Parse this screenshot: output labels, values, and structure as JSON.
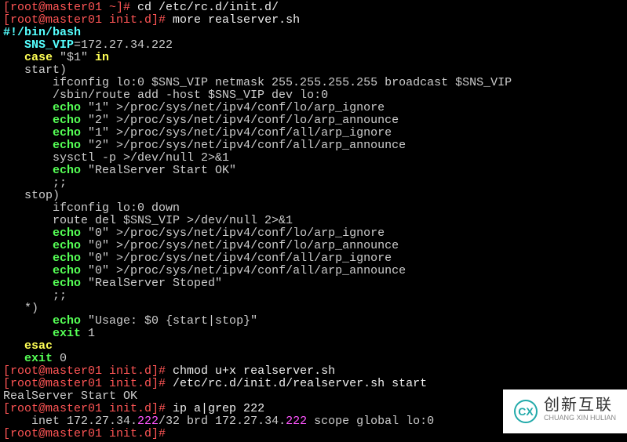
{
  "terminal": {
    "lines": [
      {
        "segments": [
          {
            "text": "[root@master01 ~]# ",
            "class": "red"
          },
          {
            "text": "cd /etc/rc.d/init.d/",
            "class": "white"
          }
        ]
      },
      {
        "segments": [
          {
            "text": "[root@master01 init.d]# ",
            "class": "red"
          },
          {
            "text": "more realserver.sh",
            "class": "white"
          }
        ]
      },
      {
        "segments": [
          {
            "text": "#!/bin/bash",
            "class": "cyan-bold"
          }
        ]
      },
      {
        "segments": [
          {
            "text": "   ",
            "class": "gray"
          },
          {
            "text": "SNS_VIP",
            "class": "cyan-bold"
          },
          {
            "text": "=172.27.34.222",
            "class": "gray"
          }
        ]
      },
      {
        "segments": [
          {
            "text": "   ",
            "class": "gray"
          },
          {
            "text": "case",
            "class": "yellow-bold"
          },
          {
            "text": " \"$1\" ",
            "class": "gray"
          },
          {
            "text": "in",
            "class": "yellow-bold"
          }
        ]
      },
      {
        "segments": [
          {
            "text": "   start)",
            "class": "gray"
          }
        ]
      },
      {
        "segments": [
          {
            "text": "       ifconfig lo:0 $SNS_VIP netmask 255.255.255.255 broadcast $SNS_VIP",
            "class": "gray"
          }
        ]
      },
      {
        "segments": [
          {
            "text": "       /sbin/route add -host $SNS_VIP dev lo:0",
            "class": "gray"
          }
        ]
      },
      {
        "segments": [
          {
            "text": "       ",
            "class": "gray"
          },
          {
            "text": "echo",
            "class": "green-bold"
          },
          {
            "text": " \"1\" >/proc/sys/net/ipv4/conf/lo/arp_ignore",
            "class": "gray"
          }
        ]
      },
      {
        "segments": [
          {
            "text": "       ",
            "class": "gray"
          },
          {
            "text": "echo",
            "class": "green-bold"
          },
          {
            "text": " \"2\" >/proc/sys/net/ipv4/conf/lo/arp_announce",
            "class": "gray"
          }
        ]
      },
      {
        "segments": [
          {
            "text": "       ",
            "class": "gray"
          },
          {
            "text": "echo",
            "class": "green-bold"
          },
          {
            "text": " \"1\" >/proc/sys/net/ipv4/conf/all/arp_ignore",
            "class": "gray"
          }
        ]
      },
      {
        "segments": [
          {
            "text": "       ",
            "class": "gray"
          },
          {
            "text": "echo",
            "class": "green-bold"
          },
          {
            "text": " \"2\" >/proc/sys/net/ipv4/conf/all/arp_announce",
            "class": "gray"
          }
        ]
      },
      {
        "segments": [
          {
            "text": "       sysctl -p >/dev/null 2>&1",
            "class": "gray"
          }
        ]
      },
      {
        "segments": [
          {
            "text": "       ",
            "class": "gray"
          },
          {
            "text": "echo",
            "class": "green-bold"
          },
          {
            "text": " \"RealServer Start OK\"",
            "class": "gray"
          }
        ]
      },
      {
        "segments": [
          {
            "text": "       ;;",
            "class": "gray"
          }
        ]
      },
      {
        "segments": [
          {
            "text": "   stop)",
            "class": "gray"
          }
        ]
      },
      {
        "segments": [
          {
            "text": "       ifconfig lo:0 down",
            "class": "gray"
          }
        ]
      },
      {
        "segments": [
          {
            "text": "       route del $SNS_VIP >/dev/null 2>&1",
            "class": "gray"
          }
        ]
      },
      {
        "segments": [
          {
            "text": "       ",
            "class": "gray"
          },
          {
            "text": "echo",
            "class": "green-bold"
          },
          {
            "text": " \"0\" >/proc/sys/net/ipv4/conf/lo/arp_ignore",
            "class": "gray"
          }
        ]
      },
      {
        "segments": [
          {
            "text": "       ",
            "class": "gray"
          },
          {
            "text": "echo",
            "class": "green-bold"
          },
          {
            "text": " \"0\" >/proc/sys/net/ipv4/conf/lo/arp_announce",
            "class": "gray"
          }
        ]
      },
      {
        "segments": [
          {
            "text": "       ",
            "class": "gray"
          },
          {
            "text": "echo",
            "class": "green-bold"
          },
          {
            "text": " \"0\" >/proc/sys/net/ipv4/conf/all/arp_ignore",
            "class": "gray"
          }
        ]
      },
      {
        "segments": [
          {
            "text": "       ",
            "class": "gray"
          },
          {
            "text": "echo",
            "class": "green-bold"
          },
          {
            "text": " \"0\" >/proc/sys/net/ipv4/conf/all/arp_announce",
            "class": "gray"
          }
        ]
      },
      {
        "segments": [
          {
            "text": "       ",
            "class": "gray"
          },
          {
            "text": "echo",
            "class": "green-bold"
          },
          {
            "text": " \"RealServer Stoped\"",
            "class": "gray"
          }
        ]
      },
      {
        "segments": [
          {
            "text": "       ;;",
            "class": "gray"
          }
        ]
      },
      {
        "segments": [
          {
            "text": "   *)",
            "class": "gray"
          }
        ]
      },
      {
        "segments": [
          {
            "text": "       ",
            "class": "gray"
          },
          {
            "text": "echo",
            "class": "green-bold"
          },
          {
            "text": " \"Usage: $0 {start|stop}\"",
            "class": "gray"
          }
        ]
      },
      {
        "segments": [
          {
            "text": "       ",
            "class": "gray"
          },
          {
            "text": "exit",
            "class": "green-bold"
          },
          {
            "text": " 1",
            "class": "gray"
          }
        ]
      },
      {
        "segments": [
          {
            "text": "   ",
            "class": "gray"
          },
          {
            "text": "esac",
            "class": "yellow-bold"
          }
        ]
      },
      {
        "segments": [
          {
            "text": "   ",
            "class": "gray"
          },
          {
            "text": "exit",
            "class": "green-bold"
          },
          {
            "text": " 0",
            "class": "gray"
          }
        ]
      },
      {
        "segments": [
          {
            "text": "[root@master01 init.d]# ",
            "class": "red"
          },
          {
            "text": "chmod u+x realserver.sh",
            "class": "white"
          }
        ]
      },
      {
        "segments": [
          {
            "text": "[root@master01 init.d]# ",
            "class": "red"
          },
          {
            "text": "/etc/rc.d/init.d/realserver.sh start",
            "class": "white"
          }
        ]
      },
      {
        "segments": [
          {
            "text": "RealServer Start OK",
            "class": "gray"
          }
        ]
      },
      {
        "segments": [
          {
            "text": "[root@master01 init.d]# ",
            "class": "red"
          },
          {
            "text": "ip a|grep 222",
            "class": "white"
          }
        ]
      },
      {
        "segments": [
          {
            "text": "    inet 172.27.34.",
            "class": "gray"
          },
          {
            "text": "222",
            "class": "magenta"
          },
          {
            "text": "/32 brd 172.27.34.",
            "class": "gray"
          },
          {
            "text": "222",
            "class": "magenta"
          },
          {
            "text": " scope global lo:0",
            "class": "gray"
          }
        ]
      },
      {
        "segments": [
          {
            "text": "[root@master01 init.d]# ",
            "class": "red"
          }
        ]
      }
    ]
  },
  "watermark": {
    "logo": "CX",
    "text": "创新互联",
    "sub": "CHUANG XIN HULIAN"
  }
}
